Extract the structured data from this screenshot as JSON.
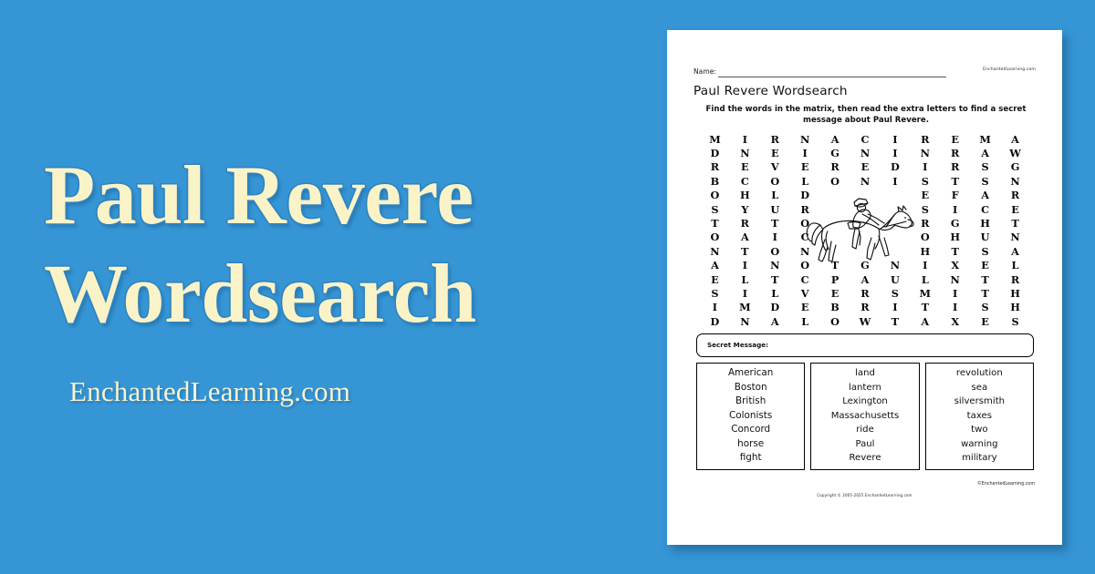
{
  "background_color": "#3595d5",
  "promo": {
    "title_line1": "Paul Revere",
    "title_line2": "Wordsearch",
    "subtitle": "EnchantedLearning.com",
    "title_color": "#faf3c8"
  },
  "worksheet": {
    "name_label": "Name:",
    "brand_top": "EnchantedLearning.com",
    "title": "Paul Revere Wordsearch",
    "instructions": "Find the words in the matrix, then read the extra letters to find a secret message about Paul Revere.",
    "secret_message_label": "Secret Message:",
    "brand_bottom": "©EnchantedLearning.com",
    "copyright": "Copyright © 2005-2025 EnchantedLearning.com",
    "illustration": "paul-revere-on-horse",
    "grid": {
      "rows": 14,
      "cols": 11,
      "letters": [
        [
          "M",
          "I",
          "R",
          "N",
          "A",
          "C",
          "I",
          "R",
          "E",
          "M",
          "A"
        ],
        [
          "D",
          "N",
          "E",
          "I",
          "G",
          "N",
          "I",
          "N",
          "R",
          "A",
          "W"
        ],
        [
          "R",
          "E",
          "V",
          "E",
          "R",
          "E",
          "D",
          "I",
          "R",
          "S",
          "G"
        ],
        [
          "B",
          "C",
          "O",
          "L",
          "O",
          "N",
          "I",
          "S",
          "T",
          "S",
          "N"
        ],
        [
          "O",
          "H",
          "L",
          "D",
          "",
          "",
          "",
          "E",
          "F",
          "A",
          "R"
        ],
        [
          "S",
          "Y",
          "U",
          "R",
          "",
          "",
          "",
          "S",
          "I",
          "C",
          "E"
        ],
        [
          "T",
          "R",
          "T",
          "O",
          "",
          "",
          "",
          "R",
          "G",
          "H",
          "T"
        ],
        [
          "O",
          "A",
          "I",
          "C",
          "",
          "",
          "",
          "O",
          "H",
          "U",
          "N"
        ],
        [
          "N",
          "T",
          "O",
          "N",
          "",
          "",
          "",
          "H",
          "T",
          "S",
          "A"
        ],
        [
          "A",
          "I",
          "N",
          "O",
          "T",
          "G",
          "N",
          "I",
          "X",
          "E",
          "L"
        ],
        [
          "E",
          "L",
          "T",
          "C",
          "P",
          "A",
          "U",
          "L",
          "N",
          "T",
          "R"
        ],
        [
          "S",
          "I",
          "L",
          "V",
          "E",
          "R",
          "S",
          "M",
          "I",
          "T",
          "H"
        ],
        [
          "I",
          "M",
          "D",
          "E",
          "B",
          "R",
          "I",
          "T",
          "I",
          "S",
          "H"
        ],
        [
          "D",
          "N",
          "A",
          "L",
          "O",
          "W",
          "T",
          "A",
          "X",
          "E",
          "S"
        ]
      ]
    },
    "word_columns": [
      {
        "words": [
          "American",
          "Boston",
          "British",
          "Colonists",
          "Concord",
          "horse",
          "fight"
        ]
      },
      {
        "words": [
          "land",
          "lantern",
          "Lexington",
          "Massachusetts",
          "ride",
          "Paul",
          "Revere"
        ]
      },
      {
        "words": [
          "revolution",
          "sea",
          "silversmith",
          "taxes",
          "two",
          "warning",
          "military"
        ]
      }
    ]
  }
}
